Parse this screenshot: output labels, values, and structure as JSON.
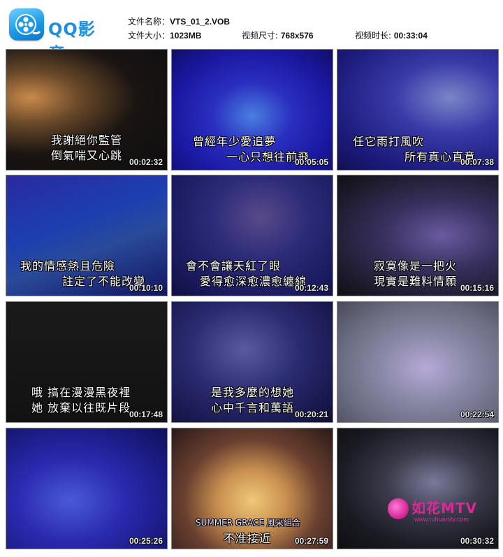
{
  "app": {
    "name": "QQ影音"
  },
  "file": {
    "name_label": "文件名称：",
    "name": "VTS_01_2.VOB",
    "size_label": "文件大小：",
    "size": "1023MB",
    "dims_label": "视频尺寸: ",
    "dims": "768x576",
    "duration_label": "视频时长: ",
    "duration": "00:33:04"
  },
  "thumbnails": [
    {
      "time": "00:02:32",
      "lines": [
        "我謝絕你監管",
        "倒氣喘又心跳"
      ]
    },
    {
      "time": "00:05:05",
      "lines": [
        "曾經年少愛追夢",
        "一心只想往前飛"
      ]
    },
    {
      "time": "00:07:38",
      "lines": [
        "任它雨打風吹",
        "所有真心直意"
      ]
    },
    {
      "time": "00:10:10",
      "lines": [
        "我的情感熱且危險",
        "註定了不能改變"
      ]
    },
    {
      "time": "00:12:43",
      "lines": [
        "會不會讓天紅了眼",
        "愛得愈深愈濃愈纏綿"
      ]
    },
    {
      "time": "00:15:16",
      "lines": [
        "寂寞像是一把火",
        "現實是難料情願"
      ]
    },
    {
      "time": "00:17:48",
      "lines": [
        "哦  搞在漫漫黑夜裡",
        "她  放棄以往既片段"
      ]
    },
    {
      "time": "00:20:21",
      "lines": [
        "是我多麼的想她",
        "心中千言和萬語"
      ]
    },
    {
      "time": "00:22:54",
      "lines": []
    },
    {
      "time": "00:25:26",
      "lines": []
    },
    {
      "time": "00:27:59",
      "lines": [
        "SUMMER GRACE  風采組合",
        "不准接近"
      ]
    },
    {
      "time": "00:30:32",
      "lines": []
    }
  ],
  "watermark": {
    "title": "如花MTV",
    "url": "www.ruhuamtv.com"
  },
  "colors": {
    "brand": "#1e8fe0",
    "watermark": "#e0259b"
  }
}
